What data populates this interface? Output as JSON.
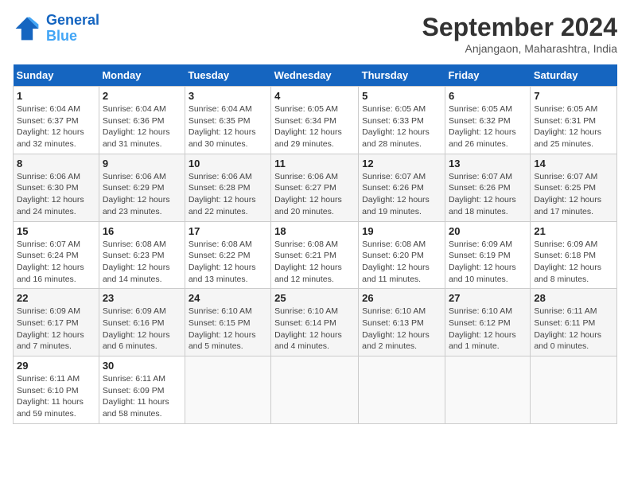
{
  "header": {
    "logo_line1": "General",
    "logo_line2": "Blue",
    "month_title": "September 2024",
    "subtitle": "Anjangaon, Maharashtra, India"
  },
  "weekdays": [
    "Sunday",
    "Monday",
    "Tuesday",
    "Wednesday",
    "Thursday",
    "Friday",
    "Saturday"
  ],
  "weeks": [
    [
      {
        "day": "1",
        "info": "Sunrise: 6:04 AM\nSunset: 6:37 PM\nDaylight: 12 hours\nand 32 minutes."
      },
      {
        "day": "2",
        "info": "Sunrise: 6:04 AM\nSunset: 6:36 PM\nDaylight: 12 hours\nand 31 minutes."
      },
      {
        "day": "3",
        "info": "Sunrise: 6:04 AM\nSunset: 6:35 PM\nDaylight: 12 hours\nand 30 minutes."
      },
      {
        "day": "4",
        "info": "Sunrise: 6:05 AM\nSunset: 6:34 PM\nDaylight: 12 hours\nand 29 minutes."
      },
      {
        "day": "5",
        "info": "Sunrise: 6:05 AM\nSunset: 6:33 PM\nDaylight: 12 hours\nand 28 minutes."
      },
      {
        "day": "6",
        "info": "Sunrise: 6:05 AM\nSunset: 6:32 PM\nDaylight: 12 hours\nand 26 minutes."
      },
      {
        "day": "7",
        "info": "Sunrise: 6:05 AM\nSunset: 6:31 PM\nDaylight: 12 hours\nand 25 minutes."
      }
    ],
    [
      {
        "day": "8",
        "info": "Sunrise: 6:06 AM\nSunset: 6:30 PM\nDaylight: 12 hours\nand 24 minutes."
      },
      {
        "day": "9",
        "info": "Sunrise: 6:06 AM\nSunset: 6:29 PM\nDaylight: 12 hours\nand 23 minutes."
      },
      {
        "day": "10",
        "info": "Sunrise: 6:06 AM\nSunset: 6:28 PM\nDaylight: 12 hours\nand 22 minutes."
      },
      {
        "day": "11",
        "info": "Sunrise: 6:06 AM\nSunset: 6:27 PM\nDaylight: 12 hours\nand 20 minutes."
      },
      {
        "day": "12",
        "info": "Sunrise: 6:07 AM\nSunset: 6:26 PM\nDaylight: 12 hours\nand 19 minutes."
      },
      {
        "day": "13",
        "info": "Sunrise: 6:07 AM\nSunset: 6:26 PM\nDaylight: 12 hours\nand 18 minutes."
      },
      {
        "day": "14",
        "info": "Sunrise: 6:07 AM\nSunset: 6:25 PM\nDaylight: 12 hours\nand 17 minutes."
      }
    ],
    [
      {
        "day": "15",
        "info": "Sunrise: 6:07 AM\nSunset: 6:24 PM\nDaylight: 12 hours\nand 16 minutes."
      },
      {
        "day": "16",
        "info": "Sunrise: 6:08 AM\nSunset: 6:23 PM\nDaylight: 12 hours\nand 14 minutes."
      },
      {
        "day": "17",
        "info": "Sunrise: 6:08 AM\nSunset: 6:22 PM\nDaylight: 12 hours\nand 13 minutes."
      },
      {
        "day": "18",
        "info": "Sunrise: 6:08 AM\nSunset: 6:21 PM\nDaylight: 12 hours\nand 12 minutes."
      },
      {
        "day": "19",
        "info": "Sunrise: 6:08 AM\nSunset: 6:20 PM\nDaylight: 12 hours\nand 11 minutes."
      },
      {
        "day": "20",
        "info": "Sunrise: 6:09 AM\nSunset: 6:19 PM\nDaylight: 12 hours\nand 10 minutes."
      },
      {
        "day": "21",
        "info": "Sunrise: 6:09 AM\nSunset: 6:18 PM\nDaylight: 12 hours\nand 8 minutes."
      }
    ],
    [
      {
        "day": "22",
        "info": "Sunrise: 6:09 AM\nSunset: 6:17 PM\nDaylight: 12 hours\nand 7 minutes."
      },
      {
        "day": "23",
        "info": "Sunrise: 6:09 AM\nSunset: 6:16 PM\nDaylight: 12 hours\nand 6 minutes."
      },
      {
        "day": "24",
        "info": "Sunrise: 6:10 AM\nSunset: 6:15 PM\nDaylight: 12 hours\nand 5 minutes."
      },
      {
        "day": "25",
        "info": "Sunrise: 6:10 AM\nSunset: 6:14 PM\nDaylight: 12 hours\nand 4 minutes."
      },
      {
        "day": "26",
        "info": "Sunrise: 6:10 AM\nSunset: 6:13 PM\nDaylight: 12 hours\nand 2 minutes."
      },
      {
        "day": "27",
        "info": "Sunrise: 6:10 AM\nSunset: 6:12 PM\nDaylight: 12 hours\nand 1 minute."
      },
      {
        "day": "28",
        "info": "Sunrise: 6:11 AM\nSunset: 6:11 PM\nDaylight: 12 hours\nand 0 minutes."
      }
    ],
    [
      {
        "day": "29",
        "info": "Sunrise: 6:11 AM\nSunset: 6:10 PM\nDaylight: 11 hours\nand 59 minutes."
      },
      {
        "day": "30",
        "info": "Sunrise: 6:11 AM\nSunset: 6:09 PM\nDaylight: 11 hours\nand 58 minutes."
      },
      {
        "day": "",
        "info": ""
      },
      {
        "day": "",
        "info": ""
      },
      {
        "day": "",
        "info": ""
      },
      {
        "day": "",
        "info": ""
      },
      {
        "day": "",
        "info": ""
      }
    ]
  ]
}
